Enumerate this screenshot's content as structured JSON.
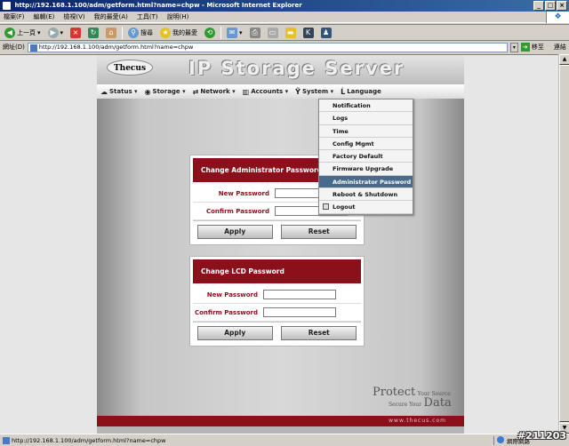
{
  "window": {
    "title": "http://192.168.1.100/adm/getform.html?name=chpw - Microsoft Internet Explorer"
  },
  "menubar": [
    "檔案(F)",
    "編輯(E)",
    "檢視(V)",
    "我的最愛(A)",
    "工具(T)",
    "說明(H)"
  ],
  "toolbar": {
    "back": "上一頁",
    "search": "搜尋",
    "favorites": "我的最愛"
  },
  "address": {
    "label": "網址(D)",
    "url": "http://192.168.1.100/adm/getform.html?name=chpw",
    "go": "移至",
    "links": "連結"
  },
  "page": {
    "logo": "Thecus",
    "brand": "IP Storage Server",
    "nav": [
      {
        "icon": "status-icon",
        "label": "Status ▾"
      },
      {
        "icon": "storage-icon",
        "label": "Storage ▾"
      },
      {
        "icon": "network-icon",
        "label": "Network ▾"
      },
      {
        "icon": "accounts-icon",
        "label": "Accounts ▾"
      },
      {
        "icon": "system-icon",
        "label": "System ▾"
      },
      {
        "icon": "language-icon",
        "label": "Language"
      }
    ],
    "system_menu": [
      "Notification",
      "Logs",
      "Time",
      "Config Mgmt",
      "Factory Default",
      "Firmware Upgrade",
      "Administrator Password",
      "Reboot & Shutdown",
      "Logout"
    ],
    "active_menu_item": "Administrator Password",
    "admin_panel": {
      "title": "Change Administrator Password",
      "new_label": "New Password",
      "confirm_label": "Confirm Password",
      "apply": "Apply",
      "reset": "Reset"
    },
    "lcd_panel": {
      "title": "Change LCD Password",
      "new_label": "New Password",
      "confirm_label": "Confirm Password",
      "apply": "Apply",
      "reset": "Reset"
    },
    "tagline_big1": "Protect",
    "tagline_small1": "Your Source",
    "tagline_small2": "Secure Your",
    "tagline_big2": "Data",
    "footer": "www.thecus.com"
  },
  "status": {
    "url": "http://192.168.1.100/adm/getform.html?name=chpw",
    "zone": "網際網路",
    "stamp": "#211203"
  }
}
